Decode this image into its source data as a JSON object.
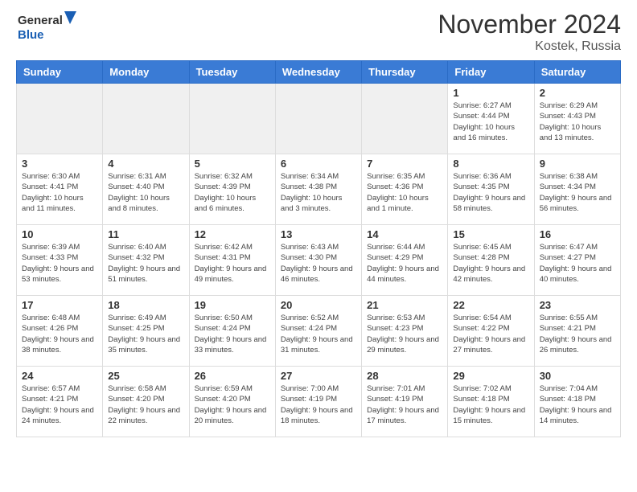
{
  "header": {
    "logo_line1": "General",
    "logo_line2": "Blue",
    "month": "November 2024",
    "location": "Kostek, Russia"
  },
  "weekdays": [
    "Sunday",
    "Monday",
    "Tuesday",
    "Wednesday",
    "Thursday",
    "Friday",
    "Saturday"
  ],
  "weeks": [
    [
      {
        "day": "",
        "info": ""
      },
      {
        "day": "",
        "info": ""
      },
      {
        "day": "",
        "info": ""
      },
      {
        "day": "",
        "info": ""
      },
      {
        "day": "",
        "info": ""
      },
      {
        "day": "1",
        "info": "Sunrise: 6:27 AM\nSunset: 4:44 PM\nDaylight: 10 hours and 16 minutes."
      },
      {
        "day": "2",
        "info": "Sunrise: 6:29 AM\nSunset: 4:43 PM\nDaylight: 10 hours and 13 minutes."
      }
    ],
    [
      {
        "day": "3",
        "info": "Sunrise: 6:30 AM\nSunset: 4:41 PM\nDaylight: 10 hours and 11 minutes."
      },
      {
        "day": "4",
        "info": "Sunrise: 6:31 AM\nSunset: 4:40 PM\nDaylight: 10 hours and 8 minutes."
      },
      {
        "day": "5",
        "info": "Sunrise: 6:32 AM\nSunset: 4:39 PM\nDaylight: 10 hours and 6 minutes."
      },
      {
        "day": "6",
        "info": "Sunrise: 6:34 AM\nSunset: 4:38 PM\nDaylight: 10 hours and 3 minutes."
      },
      {
        "day": "7",
        "info": "Sunrise: 6:35 AM\nSunset: 4:36 PM\nDaylight: 10 hours and 1 minute."
      },
      {
        "day": "8",
        "info": "Sunrise: 6:36 AM\nSunset: 4:35 PM\nDaylight: 9 hours and 58 minutes."
      },
      {
        "day": "9",
        "info": "Sunrise: 6:38 AM\nSunset: 4:34 PM\nDaylight: 9 hours and 56 minutes."
      }
    ],
    [
      {
        "day": "10",
        "info": "Sunrise: 6:39 AM\nSunset: 4:33 PM\nDaylight: 9 hours and 53 minutes."
      },
      {
        "day": "11",
        "info": "Sunrise: 6:40 AM\nSunset: 4:32 PM\nDaylight: 9 hours and 51 minutes."
      },
      {
        "day": "12",
        "info": "Sunrise: 6:42 AM\nSunset: 4:31 PM\nDaylight: 9 hours and 49 minutes."
      },
      {
        "day": "13",
        "info": "Sunrise: 6:43 AM\nSunset: 4:30 PM\nDaylight: 9 hours and 46 minutes."
      },
      {
        "day": "14",
        "info": "Sunrise: 6:44 AM\nSunset: 4:29 PM\nDaylight: 9 hours and 44 minutes."
      },
      {
        "day": "15",
        "info": "Sunrise: 6:45 AM\nSunset: 4:28 PM\nDaylight: 9 hours and 42 minutes."
      },
      {
        "day": "16",
        "info": "Sunrise: 6:47 AM\nSunset: 4:27 PM\nDaylight: 9 hours and 40 minutes."
      }
    ],
    [
      {
        "day": "17",
        "info": "Sunrise: 6:48 AM\nSunset: 4:26 PM\nDaylight: 9 hours and 38 minutes."
      },
      {
        "day": "18",
        "info": "Sunrise: 6:49 AM\nSunset: 4:25 PM\nDaylight: 9 hours and 35 minutes."
      },
      {
        "day": "19",
        "info": "Sunrise: 6:50 AM\nSunset: 4:24 PM\nDaylight: 9 hours and 33 minutes."
      },
      {
        "day": "20",
        "info": "Sunrise: 6:52 AM\nSunset: 4:24 PM\nDaylight: 9 hours and 31 minutes."
      },
      {
        "day": "21",
        "info": "Sunrise: 6:53 AM\nSunset: 4:23 PM\nDaylight: 9 hours and 29 minutes."
      },
      {
        "day": "22",
        "info": "Sunrise: 6:54 AM\nSunset: 4:22 PM\nDaylight: 9 hours and 27 minutes."
      },
      {
        "day": "23",
        "info": "Sunrise: 6:55 AM\nSunset: 4:21 PM\nDaylight: 9 hours and 26 minutes."
      }
    ],
    [
      {
        "day": "24",
        "info": "Sunrise: 6:57 AM\nSunset: 4:21 PM\nDaylight: 9 hours and 24 minutes."
      },
      {
        "day": "25",
        "info": "Sunrise: 6:58 AM\nSunset: 4:20 PM\nDaylight: 9 hours and 22 minutes."
      },
      {
        "day": "26",
        "info": "Sunrise: 6:59 AM\nSunset: 4:20 PM\nDaylight: 9 hours and 20 minutes."
      },
      {
        "day": "27",
        "info": "Sunrise: 7:00 AM\nSunset: 4:19 PM\nDaylight: 9 hours and 18 minutes."
      },
      {
        "day": "28",
        "info": "Sunrise: 7:01 AM\nSunset: 4:19 PM\nDaylight: 9 hours and 17 minutes."
      },
      {
        "day": "29",
        "info": "Sunrise: 7:02 AM\nSunset: 4:18 PM\nDaylight: 9 hours and 15 minutes."
      },
      {
        "day": "30",
        "info": "Sunrise: 7:04 AM\nSunset: 4:18 PM\nDaylight: 9 hours and 14 minutes."
      }
    ]
  ]
}
